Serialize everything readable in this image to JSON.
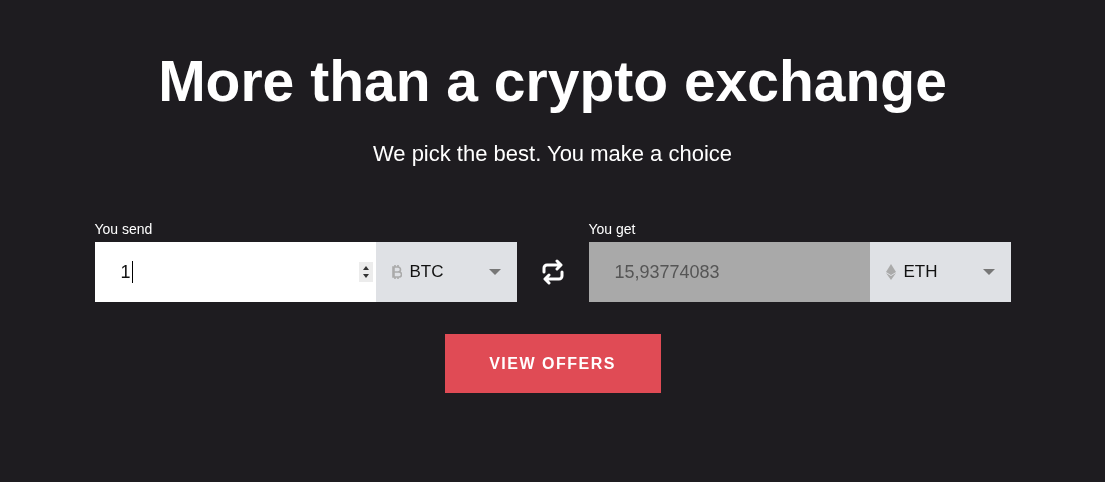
{
  "title": "More than a crypto exchange",
  "subtitle": "We pick the best. You make a choice",
  "send": {
    "label": "You send",
    "value": "1",
    "focused": true,
    "disabled": false,
    "currency": "BTC",
    "kind": "bitcoin"
  },
  "get": {
    "label": "You get",
    "value": "15,93774083",
    "focused": false,
    "disabled": true,
    "currency": "ETH",
    "kind": "ether"
  },
  "button": "VIEW OFFERS"
}
